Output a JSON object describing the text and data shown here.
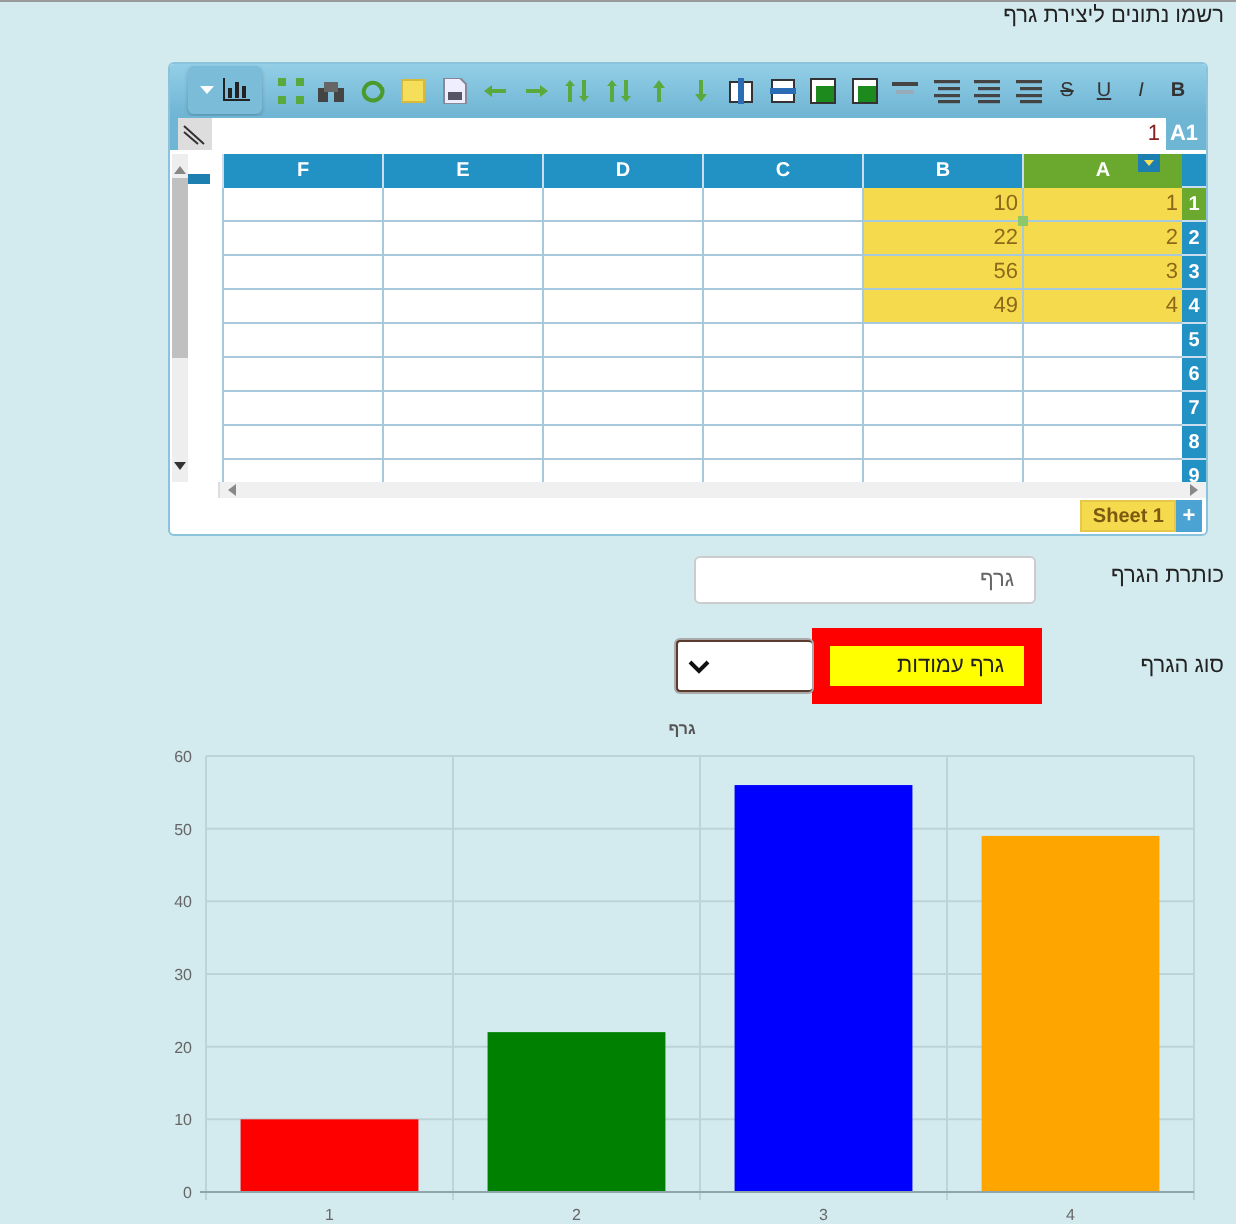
{
  "page_title": "רשמו נתונים ליצירת גרף",
  "spreadsheet": {
    "format_buttons": [
      {
        "label": "B",
        "kind": "bold"
      },
      {
        "label": "I",
        "kind": "italic"
      },
      {
        "label": "U",
        "kind": "underline"
      },
      {
        "label": "S",
        "kind": "strike"
      }
    ],
    "name_box": "A1",
    "formula": "1",
    "columns": [
      {
        "label": "A",
        "selected": true
      },
      {
        "label": "B",
        "selected": false
      },
      {
        "label": "C",
        "selected": false
      },
      {
        "label": "D",
        "selected": false
      },
      {
        "label": "E",
        "selected": false
      },
      {
        "label": "F",
        "selected": false
      }
    ],
    "rows": [
      {
        "label": "1",
        "selected": true,
        "cells": [
          {
            "value": "1",
            "highlighted": true
          },
          {
            "value": "10",
            "highlighted": true
          }
        ]
      },
      {
        "label": "2",
        "selected": false,
        "cells": [
          {
            "value": "2",
            "highlighted": true
          },
          {
            "value": "22",
            "highlighted": true
          }
        ]
      },
      {
        "label": "3",
        "selected": false,
        "cells": [
          {
            "value": "3",
            "highlighted": true
          },
          {
            "value": "56",
            "highlighted": true
          }
        ]
      },
      {
        "label": "4",
        "selected": false,
        "cells": [
          {
            "value": "4",
            "highlighted": true
          },
          {
            "value": "49",
            "highlighted": true
          }
        ]
      },
      {
        "label": "5",
        "selected": false
      },
      {
        "label": "6",
        "selected": false
      },
      {
        "label": "7",
        "selected": false
      },
      {
        "label": "8",
        "selected": false
      },
      {
        "label": "9",
        "selected": false
      }
    ],
    "sheets": [
      {
        "label": "Sheet 1",
        "selected": true
      }
    ],
    "add_sheet": "+"
  },
  "chart_title_field": {
    "label": "כותרת הגרף",
    "value": "גרף"
  },
  "chart_type_field": {
    "label": "סוג הגרף",
    "value": "גרף עמודות"
  },
  "chart": {
    "chart_data": {
      "type": "bar",
      "title": "גרף",
      "categories": [
        "1",
        "2",
        "3",
        "4"
      ],
      "series": [
        {
          "values": [
            10,
            22,
            56,
            49
          ]
        }
      ],
      "grid": true,
      "colors": [
        "#ff0000",
        "#008000",
        "#0000ff",
        "#ffa500"
      ],
      "ylim": [
        0,
        60
      ],
      "yticks": [
        0,
        10,
        20,
        30,
        40,
        50,
        60
      ]
    }
  }
}
